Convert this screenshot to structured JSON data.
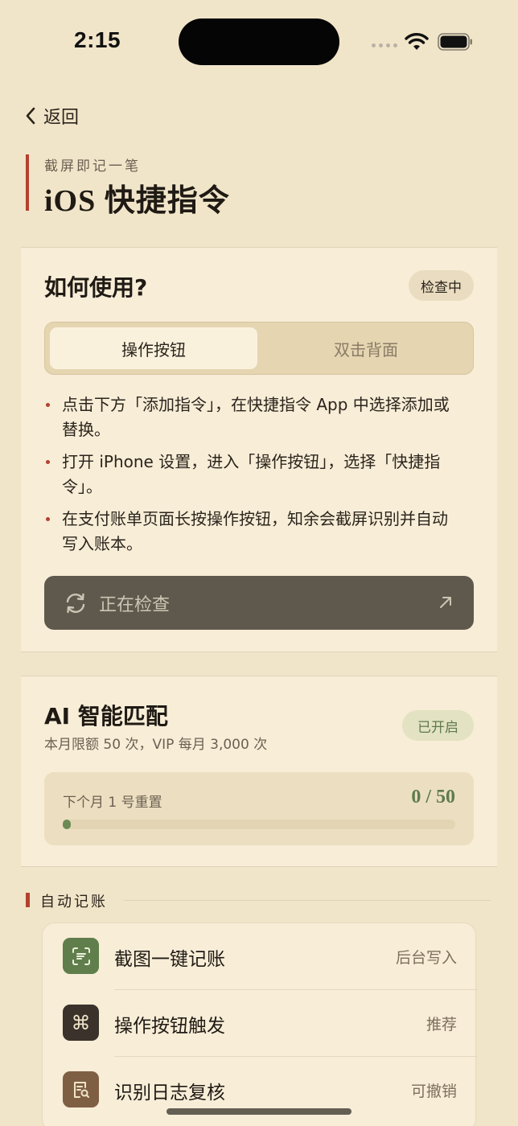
{
  "status_bar": {
    "time": "2:15"
  },
  "nav": {
    "back_label": "返回"
  },
  "header": {
    "subtitle": "截屏即记一笔",
    "title_latin": "iOS",
    "title_cjk": "快捷指令"
  },
  "usage_card": {
    "title": "如何使用?",
    "badge": "检查中",
    "tabs": [
      {
        "label": "操作按钮",
        "selected": true
      },
      {
        "label": "双击背面",
        "selected": false
      }
    ],
    "steps": [
      "点击下方「添加指令」，在快捷指令 App 中选择添加或替换。",
      "打开 iPhone 设置，进入「操作按钮」，选择「快捷指令」。",
      "在支付账单页面长按操作按钮，知余会截屏识别并自动写入账本。"
    ],
    "action_button": {
      "label": "正在检查",
      "icon": "refresh-icon",
      "trailing_icon": "arrow-up-right-icon"
    }
  },
  "ai_card": {
    "title": "AI 智能匹配",
    "subtitle": "本月限额 50 次，VIP 每月 3,000 次",
    "badge": "已开启",
    "quota": {
      "label": "下个月 1 号重置",
      "value": "0 / 50",
      "used": 0,
      "limit": 50
    }
  },
  "auto_section": {
    "title": "自动记账",
    "items": [
      {
        "name": "截图一键记账",
        "tag": "后台写入",
        "icon": "scan-text-icon",
        "icon_color": "#5f7e4b"
      },
      {
        "name": "操作按钮触发",
        "tag": "推荐",
        "icon": "command-icon",
        "icon_color": "#3a322b"
      },
      {
        "name": "识别日志复核",
        "tag": "可撤销",
        "icon": "document-search-icon",
        "icon_color": "#7f5f44"
      }
    ]
  },
  "colors": {
    "accent_red": "#b3412e",
    "accent_green": "#5f7b4d",
    "background": "#f1e5c9"
  }
}
